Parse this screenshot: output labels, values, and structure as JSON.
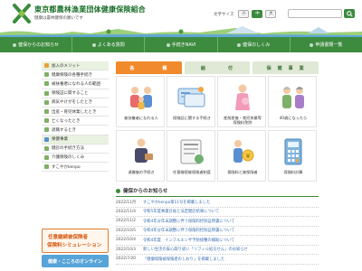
{
  "header": {
    "title": "東京都農林漁業団体健康保険組合",
    "subtitle": "健康は農林健保の願いです",
    "font_size_label": "文字サイズ",
    "font_sizes": [
      "小",
      "中",
      "大"
    ],
    "search_placeholder": ""
  },
  "nav": {
    "items": [
      {
        "label": "健保からのお知らせ",
        "icon": "info-icon"
      },
      {
        "label": "よくある質問",
        "icon": "question-icon"
      },
      {
        "label": "手続きNAVI",
        "icon": "navi-icon"
      },
      {
        "label": "健保のしくみ",
        "icon": "house-icon"
      },
      {
        "label": "申請書類一覧",
        "icon": "document-icon"
      }
    ]
  },
  "sidebar": {
    "items": [
      {
        "label": "加入のメリット"
      },
      {
        "label": "健康保険の各種手続き"
      },
      {
        "label": "被扶養者になれる人の範囲"
      },
      {
        "label": "保険証に関すること"
      },
      {
        "label": "病気やけがをしたとき"
      },
      {
        "label": "出産・育児休業したとき"
      },
      {
        "label": "亡くなったとき"
      },
      {
        "label": "退職するとき"
      },
      {
        "label": "保健事業"
      },
      {
        "label": "健診の手続き方法"
      },
      {
        "label": "介護保険のしくみ"
      },
      {
        "label": "すこやかkenpo"
      }
    ],
    "banner_line1": "任意継続被保険者",
    "banner_line2": "保険料シミュレーション",
    "banner2": "健康・こころのオンライン"
  },
  "tabs": [
    {
      "label": "各　　　　　種",
      "active": true
    },
    {
      "label": "給　　　　付",
      "active": false
    },
    {
      "label": "保　健　事　業",
      "active": false
    }
  ],
  "cards": [
    {
      "label1": "被扶養者になれる人",
      "label2": "",
      "icon": "family-icon"
    },
    {
      "label1": "保険証に関する手続き",
      "label2": "",
      "icon": "insurance-card-icon"
    },
    {
      "label1": "産前産後・育児休業等",
      "label2": "保険料免除",
      "icon": "maternity-icon"
    },
    {
      "label1": "40歳になったら",
      "label2": "",
      "icon": "elderly-couple-icon"
    },
    {
      "label1": "退職後の手続き",
      "label2": "",
      "icon": "retirement-icon"
    },
    {
      "label1": "任意継続被保険者制度",
      "label2": "",
      "icon": "continuation-icon"
    },
    {
      "label1": "保険料と被保険者",
      "label2": "",
      "icon": "premium-icon"
    },
    {
      "label1": "保険料計算",
      "label2": "",
      "icon": "calculator-icon"
    }
  ],
  "news": {
    "title": "健保からのお知らせ",
    "items": [
      {
        "date": "2022/11月",
        "text": "すこやかkenpo第11号を掲載しました"
      },
      {
        "date": "2022/11/4",
        "text": "令和5年度事業計画と法定健診結果について"
      },
      {
        "date": "2022/11/2",
        "text": "令和4年分年末調整に伴う保険料控除証明書について"
      },
      {
        "date": "2022/10/5",
        "text": "令和4年分年末調整に伴う保険料控除証明書について"
      },
      {
        "date": "2022/10/4",
        "text": "令和4年度　インフルエンザ予防接種の補助について"
      },
      {
        "date": "2022/10/3",
        "text": "新しい生活の安心取り扱い「リフィル処方せん」のお知らせ"
      },
      {
        "date": "2022/7/20",
        "text": "「健康保険被保険者のしおり」を掲載しました"
      }
    ]
  },
  "colors": {
    "brand_green": "#3d8b3f",
    "accent_orange": "#f08a2c",
    "link_blue": "#3a6fb0"
  }
}
